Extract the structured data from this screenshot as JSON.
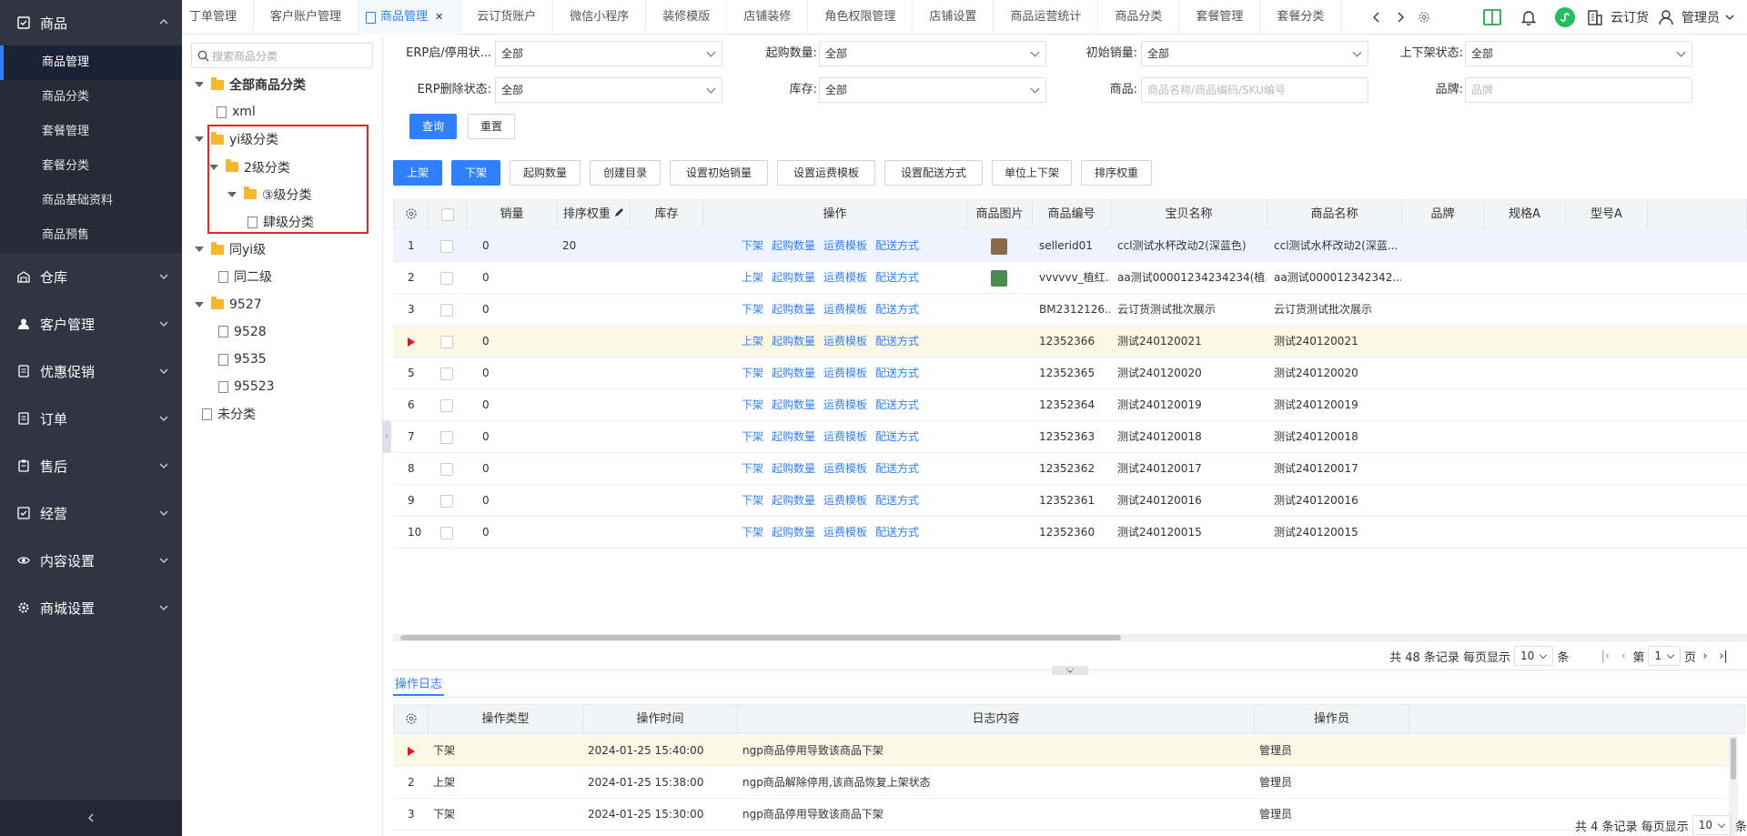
{
  "sidebar": {
    "sections": [
      {
        "label": "商品",
        "icon": "product-icon",
        "expanded": true
      },
      {
        "label": "仓库",
        "icon": "warehouse-icon"
      },
      {
        "label": "客户管理",
        "icon": "user-icon"
      },
      {
        "label": "优惠促销",
        "icon": "promotion-icon"
      },
      {
        "label": "订单",
        "icon": "order-icon"
      },
      {
        "label": "售后",
        "icon": "aftersale-icon"
      },
      {
        "label": "经营",
        "icon": "business-icon"
      },
      {
        "label": "内容设置",
        "icon": "eye-icon"
      },
      {
        "label": "商城设置",
        "icon": "gear-icon"
      }
    ],
    "product_items": [
      "商品管理",
      "商品分类",
      "套餐管理",
      "套餐分类",
      "商品基础资料",
      "商品预售"
    ]
  },
  "tabs": [
    "丁单管理",
    "客户账户管理",
    "商品管理",
    "云订货账户",
    "微信小程序",
    "装修模版",
    "店铺装修",
    "角色权限管理",
    "店铺设置",
    "商品运营统计",
    "商品分类",
    "套餐管理",
    "套餐分类"
  ],
  "topbar": {
    "brand": "云订货",
    "user": "管理员"
  },
  "tree": {
    "search_placeholder": "搜索商品分类",
    "nodes": [
      {
        "label": "全部商品分类",
        "type": "folder"
      },
      {
        "label": "xml",
        "type": "file"
      },
      {
        "label": "yi级分类",
        "type": "folder"
      },
      {
        "label": "2级分类",
        "type": "folder"
      },
      {
        "label": "③级分类",
        "type": "folder"
      },
      {
        "label": "肆级分类",
        "type": "file"
      },
      {
        "label": "同yi级",
        "type": "folder"
      },
      {
        "label": "同二级",
        "type": "file"
      },
      {
        "label": "9527",
        "type": "folder"
      },
      {
        "label": "9528",
        "type": "file"
      },
      {
        "label": "9535",
        "type": "file"
      },
      {
        "label": "95523",
        "type": "file"
      },
      {
        "label": "未分类",
        "type": "file"
      }
    ]
  },
  "filters": {
    "erp_status": {
      "label": "ERP启/停用状...",
      "value": "全部"
    },
    "min_qty": {
      "label": "起购数量:",
      "value": "全部"
    },
    "init_sales": {
      "label": "初始销量:",
      "value": "全部"
    },
    "shelf_status": {
      "label": "上下架状态:",
      "value": "全部"
    },
    "erp_delete": {
      "label": "ERP删除状态:",
      "value": "全部"
    },
    "stock": {
      "label": "库存:",
      "value": "全部"
    },
    "product": {
      "label": "商品:",
      "placeholder": "商品名称/商品编码/SKU编号"
    },
    "brand": {
      "label": "品牌:",
      "placeholder": "品牌"
    },
    "query": "查询",
    "reset": "重置"
  },
  "toolbar": [
    "上架",
    "下架",
    "起购数量",
    "创建目录",
    "设置初始销量",
    "设置运费模板",
    "设置配送方式",
    "单位上下架",
    "排序权重"
  ],
  "product_table": {
    "columns": [
      "销量",
      "排序权重",
      "库存",
      "操作",
      "商品图片",
      "商品编号",
      "宝贝名称",
      "商品名称",
      "品牌",
      "规格A",
      "型号A"
    ],
    "actions": [
      "起购数量",
      "运费模板",
      "配送方式"
    ],
    "rows": [
      {
        "no": "1",
        "sales": "0",
        "weight": "20",
        "action": "下架",
        "img": "#8a6a4a",
        "code": "sellerid01",
        "bb": "ccl测试水杯改动2(深蓝色)",
        "name": "ccl测试水杯改动2(深蓝...",
        "state": "selected"
      },
      {
        "no": "2",
        "sales": "0",
        "weight": "",
        "action": "上架",
        "img": "#4c8a52",
        "code": "vvvvvv_植红...",
        "bb": "aa测试00001234234234(植...",
        "name": "aa测试000012342342...",
        "state": ""
      },
      {
        "no": "3",
        "sales": "0",
        "weight": "",
        "action": "下架",
        "img": "",
        "code": "BM2312126...",
        "bb": "云订货测试批次展示",
        "name": "云订货测试批次展示",
        "state": ""
      },
      {
        "no": "",
        "sales": "0",
        "weight": "",
        "action": "上架",
        "img": "",
        "code": "12352366",
        "bb": "测试240120021",
        "name": "测试240120021",
        "state": "current"
      },
      {
        "no": "5",
        "sales": "0",
        "weight": "",
        "action": "下架",
        "img": "",
        "code": "12352365",
        "bb": "测试240120020",
        "name": "测试240120020",
        "state": ""
      },
      {
        "no": "6",
        "sales": "0",
        "weight": "",
        "action": "下架",
        "img": "",
        "code": "12352364",
        "bb": "测试240120019",
        "name": "测试240120019",
        "state": ""
      },
      {
        "no": "7",
        "sales": "0",
        "weight": "",
        "action": "下架",
        "img": "",
        "code": "12352363",
        "bb": "测试240120018",
        "name": "测试240120018",
        "state": ""
      },
      {
        "no": "8",
        "sales": "0",
        "weight": "",
        "action": "下架",
        "img": "",
        "code": "12352362",
        "bb": "测试240120017",
        "name": "测试240120017",
        "state": ""
      },
      {
        "no": "9",
        "sales": "0",
        "weight": "",
        "action": "下架",
        "img": "",
        "code": "12352361",
        "bb": "测试240120016",
        "name": "测试240120016",
        "state": ""
      },
      {
        "no": "10",
        "sales": "0",
        "weight": "",
        "action": "下架",
        "img": "",
        "code": "12352360",
        "bb": "测试240120015",
        "name": "测试240120015",
        "state": ""
      }
    ]
  },
  "pager1": {
    "total": "共 48 条记录",
    "per": "每页显示",
    "size": "10",
    "unit": "条",
    "page_prefix": "第",
    "page": "1",
    "page_suffix": "页"
  },
  "log": {
    "tab": "操作日志",
    "columns": [
      "操作类型",
      "操作时间",
      "日志内容",
      "操作员"
    ],
    "rows": [
      {
        "no": "",
        "type": "下架",
        "time": "2024-01-25 15:40:00",
        "content": "ngp商品停用导致该商品下架",
        "op": "管理员",
        "state": "current"
      },
      {
        "no": "2",
        "type": "上架",
        "time": "2024-01-25 15:38:00",
        "content": "ngp商品解除停用,该商品恢复上架状态",
        "op": "管理员",
        "state": ""
      },
      {
        "no": "3",
        "type": "下架",
        "time": "2024-01-25 15:30:00",
        "content": "ngp商品停用导致该商品下架",
        "op": "管理员",
        "state": ""
      }
    ]
  },
  "pager2": {
    "total": "共 4 条记录",
    "per": "每页显示",
    "size": "10",
    "unit": "条"
  }
}
